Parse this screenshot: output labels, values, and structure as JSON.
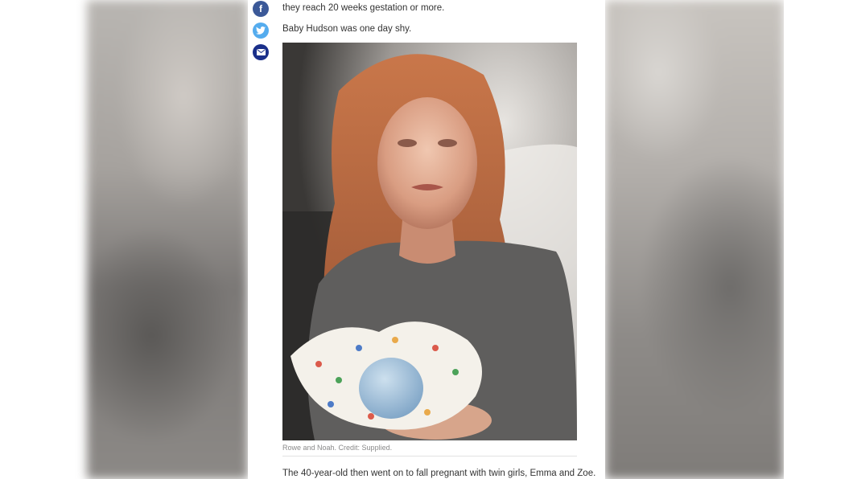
{
  "article": {
    "paragraph_top": "they reach 20 weeks gestation or more.",
    "paragraph_2": "Baby Hudson was one day shy.",
    "photo_caption": "Rowe and Noah. Credit: Supplied.",
    "paragraph_3": "The 40-year-old then went on to fall pregnant with twin girls, Emma and Zoe."
  },
  "share": {
    "facebook_icon": "facebook-icon",
    "twitter_icon": "twitter-icon",
    "email_icon": "email-icon"
  },
  "colors": {
    "facebook": "#3b5998",
    "twitter": "#55acee",
    "email": "#1a2f8a"
  }
}
